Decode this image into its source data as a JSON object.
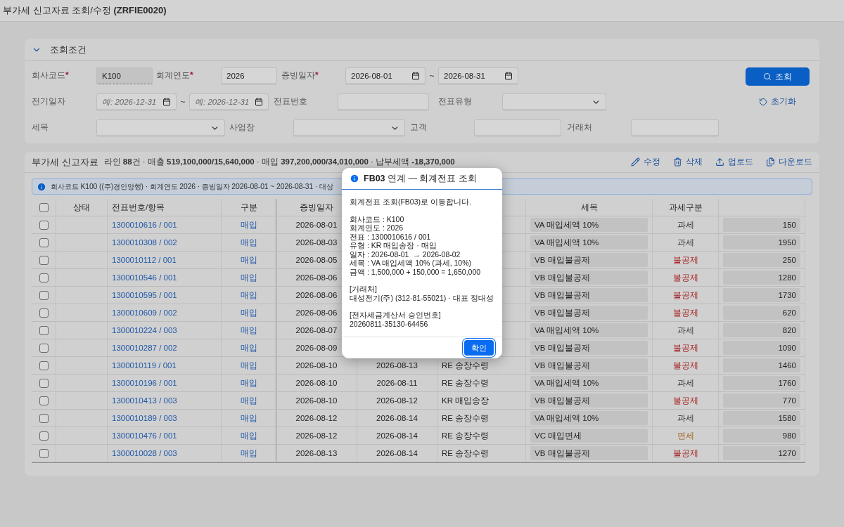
{
  "window": {
    "title": "부가세 신고자료 조회/수정 ",
    "code": "(ZRFIE0020)"
  },
  "filter": {
    "title": "조회조건",
    "expanded": true,
    "required_mark": "*",
    "company": {
      "label": "회사코드",
      "required": true,
      "value": "K100"
    },
    "year": {
      "label": "회계연도",
      "required": true,
      "value": "2026"
    },
    "evidence_date": {
      "label": "증빙일자",
      "required": true,
      "from": "2026-08-01",
      "to": "2026-08-31",
      "separator": "~"
    },
    "posting_date": {
      "label": "전기일자",
      "from_placeholder": "예: 2026-12-31",
      "to_placeholder": "예: 2026-12-31",
      "separator": "~"
    },
    "doc_no": {
      "label": "전표번호"
    },
    "doc_type": {
      "label": "전표유형"
    },
    "tax_code": {
      "label": "세목"
    },
    "business_place": {
      "label": "사업장"
    },
    "customer": {
      "label": "고객"
    },
    "vendor": {
      "label": "거래처"
    },
    "search_button": "조회",
    "reset_button": "초기화"
  },
  "results": {
    "title": "부가세 신고자료",
    "summary": "라인 **88**건 · 매출 **519,100,000/15,640,000** · 매입 **397,200,000/34,010,000** · 납부세액 **-18,370,000**",
    "actions": [
      {
        "kind": "edit",
        "label": "수정"
      },
      {
        "kind": "delete",
        "label": "삭제"
      },
      {
        "kind": "upload",
        "label": "업로드"
      },
      {
        "kind": "download",
        "label": "다운로드"
      }
    ],
    "info": "회사코드 K100 ((주)경인양행) · 회계연도 2026 · 증빙일자 2026-08-01 ~ 2026-08-31 · 대상",
    "select_all_checked": false,
    "columns": [
      {
        "label": "상태"
      },
      {
        "label": "전표번호/항목"
      },
      {
        "label": "구분"
      },
      {
        "label": "증빙일자"
      },
      {},
      {},
      {
        "label": "세목"
      },
      {
        "label": "과세구분"
      },
      {}
    ],
    "rows": [
      {
        "checked": false,
        "doc": "1300010616 / 001",
        "category": "매입",
        "evidence_date": "2026-08-01",
        "tax_code": "VA 매입세액 10%",
        "tax_class": {
          "label": "과세",
          "color": "#333333"
        },
        "column_10": "150"
      },
      {
        "checked": false,
        "doc": "1300010308 / 002",
        "category": "매입",
        "evidence_date": "2026-08-03",
        "tax_code": "VA 매입세액 10%",
        "tax_class": {
          "label": "과세",
          "color": "#333333"
        },
        "column_10": "1950"
      },
      {
        "checked": false,
        "doc": "1300010112 / 001",
        "category": "매입",
        "evidence_date": "2026-08-05",
        "tax_code": "VB 매입불공제",
        "tax_class": {
          "label": "불공제",
          "color": "#a82828"
        },
        "column_10": "250"
      },
      {
        "checked": false,
        "doc": "1300010546 / 001",
        "category": "매입",
        "evidence_date": "2026-08-06",
        "tax_code": "VB 매입불공제",
        "tax_class": {
          "label": "불공제",
          "color": "#a82828"
        },
        "column_10": "1280"
      },
      {
        "checked": false,
        "doc": "1300010595 / 001",
        "category": "매입",
        "evidence_date": "2026-08-06",
        "tax_code": "VB 매입불공제",
        "tax_class": {
          "label": "불공제",
          "color": "#a82828"
        },
        "column_10": "1730"
      },
      {
        "checked": false,
        "doc": "1300010609 / 002",
        "category": "매입",
        "evidence_date": "2026-08-06",
        "tax_code": "VB 매입불공제",
        "tax_class": {
          "label": "불공제",
          "color": "#a82828"
        },
        "column_10": "620"
      },
      {
        "checked": false,
        "doc": "1300010224 / 003",
        "category": "매입",
        "evidence_date": "2026-08-07",
        "tax_code": "VA 매입세액 10%",
        "tax_class": {
          "label": "과세",
          "color": "#333333"
        },
        "column_10": "820"
      },
      {
        "checked": false,
        "doc": "1300010287 / 002",
        "category": "매입",
        "evidence_date": "2026-08-09",
        "tax_code": "VB 매입불공제",
        "tax_class": {
          "label": "불공제",
          "color": "#a82828"
        },
        "column_10": "1090"
      },
      {
        "checked": false,
        "doc": "1300010119 / 001",
        "category": "매입",
        "evidence_date": "2026-08-10",
        "column_6": "2026-08-13",
        "column_7": "RE 송장수령",
        "tax_code": "VB 매입불공제",
        "tax_class": {
          "label": "불공제",
          "color": "#a82828"
        },
        "column_10": "1460"
      },
      {
        "checked": false,
        "doc": "1300010196 / 001",
        "category": "매입",
        "evidence_date": "2026-08-10",
        "column_6": "2026-08-11",
        "column_7": "RE 송장수령",
        "tax_code": "VA 매입세액 10%",
        "tax_class": {
          "label": "과세",
          "color": "#333333"
        },
        "column_10": "1760"
      },
      {
        "checked": false,
        "doc": "1300010413 / 003",
        "category": "매입",
        "evidence_date": "2026-08-10",
        "column_6": "2026-08-12",
        "column_7": "KR 매입송장",
        "tax_code": "VB 매입불공제",
        "tax_class": {
          "label": "불공제",
          "color": "#a82828"
        },
        "column_10": "770"
      },
      {
        "checked": false,
        "doc": "1300010189 / 003",
        "category": "매입",
        "evidence_date": "2026-08-12",
        "column_6": "2026-08-14",
        "column_7": "RE 송장수령",
        "tax_code": "VA 매입세액 10%",
        "tax_class": {
          "label": "과세",
          "color": "#333333"
        },
        "column_10": "1580"
      },
      {
        "checked": false,
        "doc": "1300010476 / 001",
        "category": "매입",
        "evidence_date": "2026-08-12",
        "column_6": "2026-08-14",
        "column_7": "RE 송장수령",
        "tax_code": "VC 매입면세",
        "tax_class": {
          "label": "면세",
          "color": "#a06418"
        },
        "column_10": "980"
      },
      {
        "checked": false,
        "doc": "1300010028 / 003",
        "category": "매입",
        "evidence_date": "2026-08-13",
        "column_6": "2026-08-14",
        "column_7": "RE 송장수령",
        "tax_code": "VB 매입불공제",
        "tax_class": {
          "label": "불공제",
          "color": "#a82828"
        },
        "column_10": "1270"
      }
    ]
  },
  "dialog": {
    "title": "**FB03** 연계 — 회계전표 조회",
    "paragraphs": [
      [
        "회계전표 조회(FB03)로 이동합니다."
      ],
      [
        "회사코드 : K100",
        "회계연도 : 2026",
        "전표 : 1300010616 / 001",
        "유형 : KR 매입송장 · 매입",
        "일자 : 2026-08-01  → 2026-08-02",
        "세목 : VA 매입세액 10% (과세, 10%)",
        "금액 : 1,500,000 + 150,000 = 1,650,000"
      ],
      [
        "[거래처]",
        "대성전기(주) (312-81-55021) · 대표 정대성"
      ],
      [
        "[전자세금계산서 승인번호]",
        "20260811-35130-64456"
      ]
    ],
    "ok_button": "확인"
  }
}
